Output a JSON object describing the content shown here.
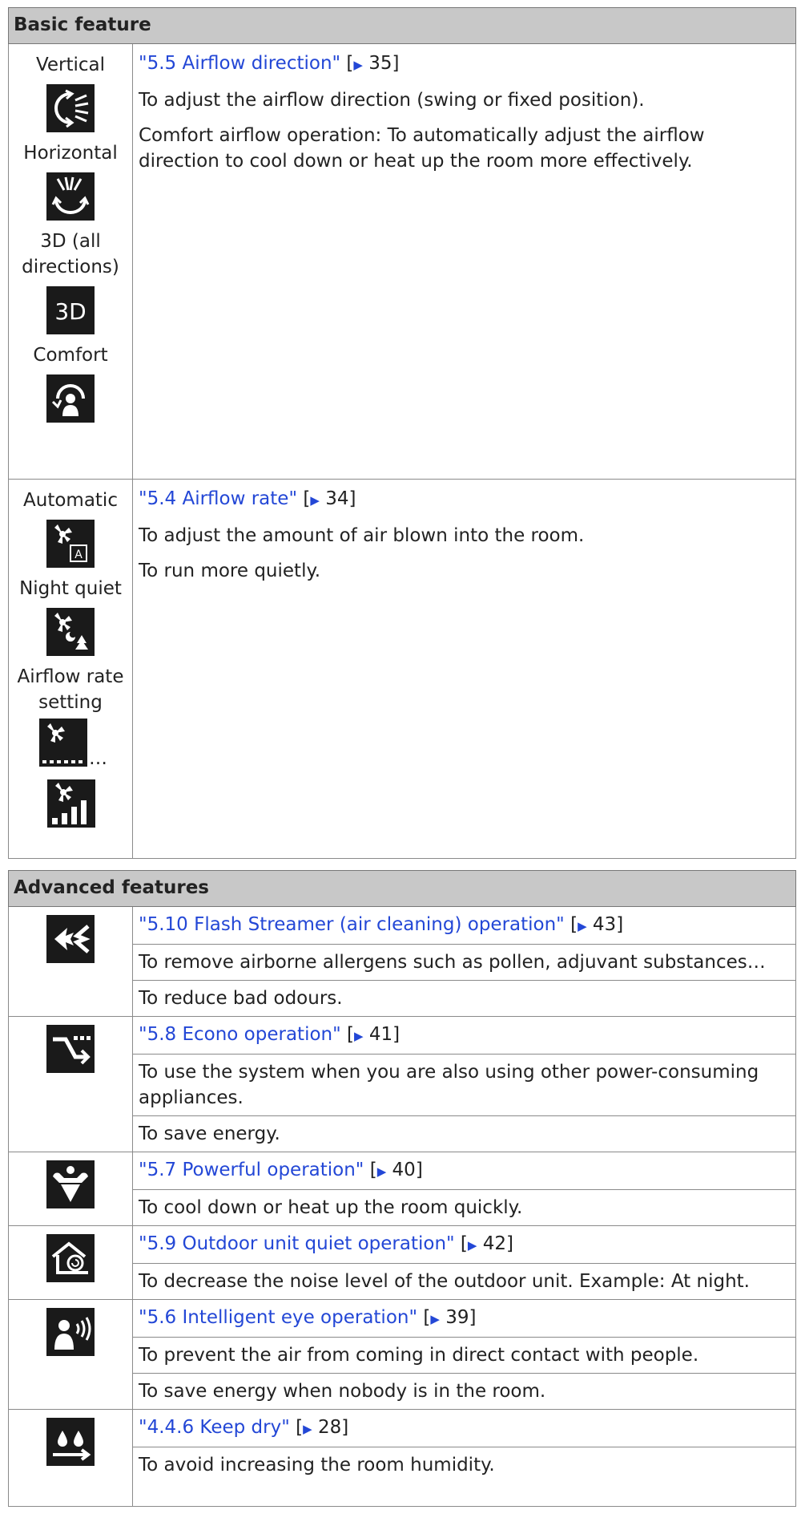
{
  "basic": {
    "header": "Basic feature",
    "rows": [
      {
        "labels": [
          "Vertical",
          "Horizontal",
          "3D (all directions)",
          "Comfort"
        ],
        "link": "\"5.5 Airflow direction\"",
        "page": "35",
        "lines": [
          "To adjust the airflow direction (swing or fixed position).",
          "Comfort airflow operation: To automatically adjust the airflow direction to cool down or heat up the room more effectively."
        ]
      },
      {
        "labels": [
          "Automatic",
          "Night quiet",
          "Airflow rate setting",
          "…"
        ],
        "link": "\"5.4 Airflow rate\"",
        "page": "34",
        "lines": [
          "To adjust the amount of air blown into the room.",
          "To run more quietly."
        ]
      }
    ]
  },
  "advanced": {
    "header": "Advanced features",
    "rows": [
      {
        "icon": "flash-streamer-icon",
        "link": "\"5.10 Flash Streamer (air cleaning) operation\"",
        "page": "43",
        "lines": [
          "To remove airborne allergens such as pollen, adjuvant substances…",
          "To reduce bad odours."
        ]
      },
      {
        "icon": "econo-icon",
        "link": "\"5.8 Econo operation\"",
        "page": "41",
        "lines": [
          "To use the system when you are also using other power-consuming appliances.",
          "To save energy."
        ]
      },
      {
        "icon": "powerful-icon",
        "link": "\"5.7 Powerful operation\"",
        "page": "40",
        "lines": [
          "To cool down or heat up the room quickly."
        ]
      },
      {
        "icon": "outdoor-quiet-icon",
        "link": "\"5.9 Outdoor unit quiet operation\"",
        "page": "42",
        "lines": [
          "To decrease the noise level of the outdoor unit. Example: At night."
        ]
      },
      {
        "icon": "intelligent-eye-icon",
        "link": "\"5.6 Intelligent eye operation\"",
        "page": "39",
        "lines": [
          "To prevent the air from coming in direct contact with people.",
          "To save energy when nobody is in the room."
        ]
      },
      {
        "icon": "keep-dry-icon",
        "link": "\"4.4.6 Keep dry\"",
        "page": "28",
        "lines": [
          "To avoid increasing the room humidity."
        ]
      }
    ]
  },
  "symbols": {
    "open_bracket": "[",
    "close_bracket": "]",
    "arrow": "▶"
  },
  "icon_text": {
    "three_d": "3D"
  }
}
